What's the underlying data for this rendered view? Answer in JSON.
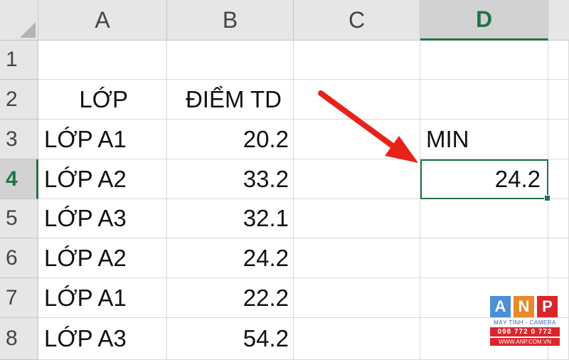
{
  "columns": [
    "A",
    "B",
    "C",
    "D"
  ],
  "active_column": "D",
  "rows": [
    "1",
    "2",
    "3",
    "4",
    "5",
    "6",
    "7",
    "8"
  ],
  "active_row": "4",
  "cells": {
    "A2": "LỚP",
    "B2": "ĐIỂM TD",
    "A3": "LỚP A1",
    "B3": "20.2",
    "D3": "MIN",
    "A4": "LỚP A2",
    "B4": "33.2",
    "D4": "24.2",
    "A5": "LỚP A3",
    "B5": "32.1",
    "A6": "LỚP A2",
    "B6": "24.2",
    "A7": "LỚP A1",
    "B7": "22.2",
    "A8": "LỚP A3",
    "B8": "54.2"
  },
  "selected_cell": "D4",
  "annotation": {
    "arrow_color": "#e8221b"
  },
  "watermark": {
    "letters": [
      "A",
      "N",
      "P"
    ],
    "letter_colors": [
      "#4a8fd8",
      "#e8892a",
      "#d9262c"
    ],
    "tagline": "MÁY TÍNH - CAMERA",
    "phone": "098 772 0 772",
    "website": "WWW.ANP.COM.VN"
  },
  "colors": {
    "header_bg": "#e6e6e6",
    "header_active_bg": "#d2d2d2",
    "accent": "#217346",
    "gridline": "#d9d9d9"
  }
}
